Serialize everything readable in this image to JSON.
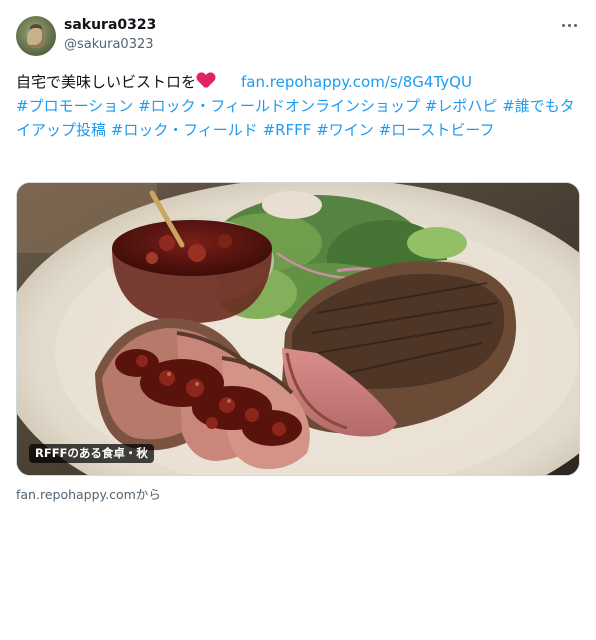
{
  "author": {
    "display_name": "sakura0323",
    "handle": "@sakura0323"
  },
  "tweet": {
    "text_main": "自宅で美味しいビストロを",
    "link": "fan.repohappy.com/s/8G4TyQU",
    "hashtags": [
      "#プロモーション",
      "#ロック・フィールドオンラインショップ",
      "#レポハピ",
      "#誰でもタイアップ投稿",
      "#ロック・フィールド",
      "#RFFF",
      "#ワイン",
      "#ローストビーフ"
    ]
  },
  "card": {
    "caption": "RFFFのある食卓・秋",
    "source": "fan.repohappy.comから"
  },
  "icons": {
    "more": "more-dots-icon",
    "heart": "red-heart-emoji"
  },
  "colors": {
    "link": "#1d9bf0",
    "text": "#0f1419",
    "muted": "#536471",
    "heart": "#e0245e"
  }
}
